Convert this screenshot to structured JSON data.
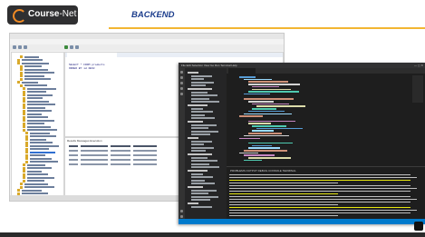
{
  "banner": {
    "logo_main": "Course",
    "logo_sub": "-Net",
    "title": "BACKEND"
  },
  "colors": {
    "accent_line": "#f2b632",
    "title_blue": "#1c3d8c",
    "logo_orange": "#f08a24",
    "vscode_status": "#007acc"
  },
  "sql_manager": {
    "tree_items": 44,
    "query_lines": [
      "SELECT * FROM products",
      "ORDER BY id DESC"
    ],
    "results_tabs": "Results   Messages   Execution",
    "result_rows": 4
  },
  "vscode": {
    "menu": "File  Edit  Selection  View  Go  Run  Terminal  Help",
    "window_buttons": "—  ▢  ✕",
    "terminal_tabs": "PROBLEMS   OUTPUT   DEBUG CONSOLE   TERMINAL",
    "status": ""
  }
}
